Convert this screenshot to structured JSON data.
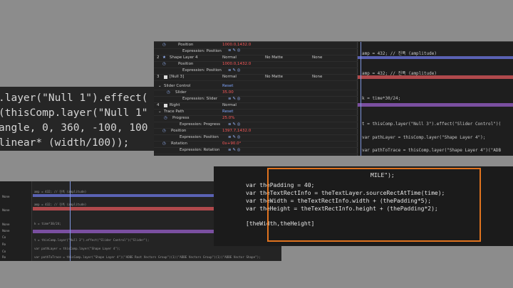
{
  "big_code": {
    "lines": [
      ".layer(\"Null 1\").effect(",
      "(thisComp.layer(\"Null 1\"",
      "angle, 0, 360, -100, 100",
      "linear* (width/100));"
    ]
  },
  "timeline": {
    "layers": [
      {
        "num": "",
        "name": "Position",
        "value": "1000.0,1432.0"
      },
      {
        "num": "",
        "name": "Expression: Position",
        "value": ""
      },
      {
        "num": "2",
        "name": "Shape Layer 4",
        "mode": "Normal",
        "matte": "No Matte",
        "parent": "None"
      },
      {
        "num": "",
        "name": "Position",
        "value": "1000.0,1432.0"
      },
      {
        "num": "",
        "name": "Expression: Position",
        "value": ""
      },
      {
        "num": "3",
        "name": "[Null 3]",
        "mode": "Normal",
        "matte": "No Matte",
        "parent": "None"
      },
      {
        "num": "",
        "name": "Slider Control",
        "value": "Reset"
      },
      {
        "num": "",
        "name": "Slider",
        "value": "35.00"
      },
      {
        "num": "",
        "name": "Expression: Slider",
        "value": ""
      },
      {
        "num": "4",
        "name": "Right",
        "mode": "Normal",
        "matte": "",
        "parent": ""
      },
      {
        "num": "",
        "name": "Trace Path",
        "value": "Reset"
      },
      {
        "num": "",
        "name": "Progress",
        "value": "25.0%"
      },
      {
        "num": "",
        "name": "Expression: Progress",
        "value": ""
      },
      {
        "num": "",
        "name": "Position",
        "value": "1397.7,1432.0"
      },
      {
        "num": "",
        "name": "Expression: Position",
        "value": ""
      },
      {
        "num": "",
        "name": "Rotation",
        "value": "0x+90.0°"
      },
      {
        "num": "",
        "name": "Expression: Rotation",
        "value": ""
      }
    ],
    "expressions": [
      "amp = 432; // 진폭 (amplitude)",
      "amp = 432; // 진폭 (amplitude)",
      "k = time*30/24;",
      "t = thisComp.layer(\"Null 3\").effect(\"Slider Control\")(",
      "var pathLayer = thisComp.layer(\"Shape Layer 4\");",
      "var pathToTrace = thisComp.layer(\"Shape Layer 4\")(\"ADB"
    ]
  },
  "lower_timeline": {
    "left_col": [
      "None",
      "None",
      "None",
      "None",
      "Co",
      "Ro",
      "Co",
      "Ro"
    ],
    "expressions": [
      "amp = 432; // 진폭 (amplitude)",
      "amp = 432; // 진폭 (amplitude)",
      "k = time*30/24;",
      "t = thisComp.layer(\"Null 3\").effect(\"Slider Control\")(\"Slider\");",
      "var pathLayer = thisComp.layer(\"Shape Layer 4\");",
      "var pathToTrace = thisComp.layer(\"Shape Layer 4\")(\"ADBE Root Vectors Group\")(1)(\"ADBE Vectors Group\")(1)(\"ADBE Vector Shape\");"
    ]
  },
  "editor": {
    "fragment_top": "MILE\");",
    "lines": [
      "var thePadding = 40;",
      "var theTextRectInfo = theTextLayer.sourceRectAtTime(time);",
      "var theWidth = theTextRectInfo.width + (thePadding*5);",
      "var theHeight = theTextRectInfo.height + (thePadding*2);",
      "",
      "[theWidth,theHeight]"
    ]
  },
  "colors": {
    "accent_orange": "#e0731f",
    "bar_blue": "#5a62b4",
    "bar_red": "#b0494c",
    "bar_purple": "#7a4fa0",
    "playhead": "#9fb8ff"
  }
}
